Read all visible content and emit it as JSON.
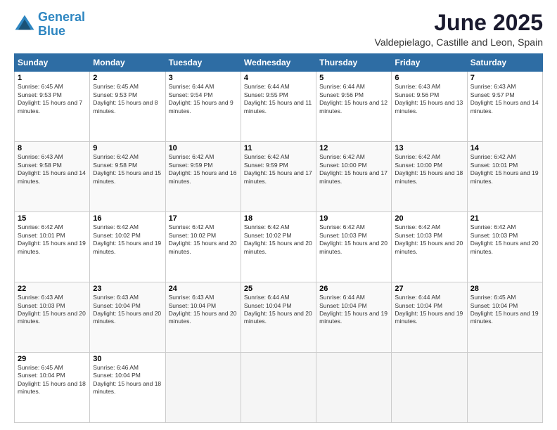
{
  "header": {
    "logo_line1": "General",
    "logo_line2": "Blue",
    "title": "June 2025",
    "subtitle": "Valdepielago, Castille and Leon, Spain"
  },
  "weekdays": [
    "Sunday",
    "Monday",
    "Tuesday",
    "Wednesday",
    "Thursday",
    "Friday",
    "Saturday"
  ],
  "weeks": [
    [
      {
        "day": "1",
        "sunrise": "Sunrise: 6:45 AM",
        "sunset": "Sunset: 9:53 PM",
        "daylight": "Daylight: 15 hours and 7 minutes."
      },
      {
        "day": "2",
        "sunrise": "Sunrise: 6:45 AM",
        "sunset": "Sunset: 9:53 PM",
        "daylight": "Daylight: 15 hours and 8 minutes."
      },
      {
        "day": "3",
        "sunrise": "Sunrise: 6:44 AM",
        "sunset": "Sunset: 9:54 PM",
        "daylight": "Daylight: 15 hours and 9 minutes."
      },
      {
        "day": "4",
        "sunrise": "Sunrise: 6:44 AM",
        "sunset": "Sunset: 9:55 PM",
        "daylight": "Daylight: 15 hours and 11 minutes."
      },
      {
        "day": "5",
        "sunrise": "Sunrise: 6:44 AM",
        "sunset": "Sunset: 9:56 PM",
        "daylight": "Daylight: 15 hours and 12 minutes."
      },
      {
        "day": "6",
        "sunrise": "Sunrise: 6:43 AM",
        "sunset": "Sunset: 9:56 PM",
        "daylight": "Daylight: 15 hours and 13 minutes."
      },
      {
        "day": "7",
        "sunrise": "Sunrise: 6:43 AM",
        "sunset": "Sunset: 9:57 PM",
        "daylight": "Daylight: 15 hours and 14 minutes."
      }
    ],
    [
      {
        "day": "8",
        "sunrise": "Sunrise: 6:43 AM",
        "sunset": "Sunset: 9:58 PM",
        "daylight": "Daylight: 15 hours and 14 minutes."
      },
      {
        "day": "9",
        "sunrise": "Sunrise: 6:42 AM",
        "sunset": "Sunset: 9:58 PM",
        "daylight": "Daylight: 15 hours and 15 minutes."
      },
      {
        "day": "10",
        "sunrise": "Sunrise: 6:42 AM",
        "sunset": "Sunset: 9:59 PM",
        "daylight": "Daylight: 15 hours and 16 minutes."
      },
      {
        "day": "11",
        "sunrise": "Sunrise: 6:42 AM",
        "sunset": "Sunset: 9:59 PM",
        "daylight": "Daylight: 15 hours and 17 minutes."
      },
      {
        "day": "12",
        "sunrise": "Sunrise: 6:42 AM",
        "sunset": "Sunset: 10:00 PM",
        "daylight": "Daylight: 15 hours and 17 minutes."
      },
      {
        "day": "13",
        "sunrise": "Sunrise: 6:42 AM",
        "sunset": "Sunset: 10:00 PM",
        "daylight": "Daylight: 15 hours and 18 minutes."
      },
      {
        "day": "14",
        "sunrise": "Sunrise: 6:42 AM",
        "sunset": "Sunset: 10:01 PM",
        "daylight": "Daylight: 15 hours and 19 minutes."
      }
    ],
    [
      {
        "day": "15",
        "sunrise": "Sunrise: 6:42 AM",
        "sunset": "Sunset: 10:01 PM",
        "daylight": "Daylight: 15 hours and 19 minutes."
      },
      {
        "day": "16",
        "sunrise": "Sunrise: 6:42 AM",
        "sunset": "Sunset: 10:02 PM",
        "daylight": "Daylight: 15 hours and 19 minutes."
      },
      {
        "day": "17",
        "sunrise": "Sunrise: 6:42 AM",
        "sunset": "Sunset: 10:02 PM",
        "daylight": "Daylight: 15 hours and 20 minutes."
      },
      {
        "day": "18",
        "sunrise": "Sunrise: 6:42 AM",
        "sunset": "Sunset: 10:02 PM",
        "daylight": "Daylight: 15 hours and 20 minutes."
      },
      {
        "day": "19",
        "sunrise": "Sunrise: 6:42 AM",
        "sunset": "Sunset: 10:03 PM",
        "daylight": "Daylight: 15 hours and 20 minutes."
      },
      {
        "day": "20",
        "sunrise": "Sunrise: 6:42 AM",
        "sunset": "Sunset: 10:03 PM",
        "daylight": "Daylight: 15 hours and 20 minutes."
      },
      {
        "day": "21",
        "sunrise": "Sunrise: 6:42 AM",
        "sunset": "Sunset: 10:03 PM",
        "daylight": "Daylight: 15 hours and 20 minutes."
      }
    ],
    [
      {
        "day": "22",
        "sunrise": "Sunrise: 6:43 AM",
        "sunset": "Sunset: 10:03 PM",
        "daylight": "Daylight: 15 hours and 20 minutes."
      },
      {
        "day": "23",
        "sunrise": "Sunrise: 6:43 AM",
        "sunset": "Sunset: 10:04 PM",
        "daylight": "Daylight: 15 hours and 20 minutes."
      },
      {
        "day": "24",
        "sunrise": "Sunrise: 6:43 AM",
        "sunset": "Sunset: 10:04 PM",
        "daylight": "Daylight: 15 hours and 20 minutes."
      },
      {
        "day": "25",
        "sunrise": "Sunrise: 6:44 AM",
        "sunset": "Sunset: 10:04 PM",
        "daylight": "Daylight: 15 hours and 20 minutes."
      },
      {
        "day": "26",
        "sunrise": "Sunrise: 6:44 AM",
        "sunset": "Sunset: 10:04 PM",
        "daylight": "Daylight: 15 hours and 19 minutes."
      },
      {
        "day": "27",
        "sunrise": "Sunrise: 6:44 AM",
        "sunset": "Sunset: 10:04 PM",
        "daylight": "Daylight: 15 hours and 19 minutes."
      },
      {
        "day": "28",
        "sunrise": "Sunrise: 6:45 AM",
        "sunset": "Sunset: 10:04 PM",
        "daylight": "Daylight: 15 hours and 19 minutes."
      }
    ],
    [
      {
        "day": "29",
        "sunrise": "Sunrise: 6:45 AM",
        "sunset": "Sunset: 10:04 PM",
        "daylight": "Daylight: 15 hours and 18 minutes."
      },
      {
        "day": "30",
        "sunrise": "Sunrise: 6:46 AM",
        "sunset": "Sunset: 10:04 PM",
        "daylight": "Daylight: 15 hours and 18 minutes."
      },
      null,
      null,
      null,
      null,
      null
    ]
  ]
}
